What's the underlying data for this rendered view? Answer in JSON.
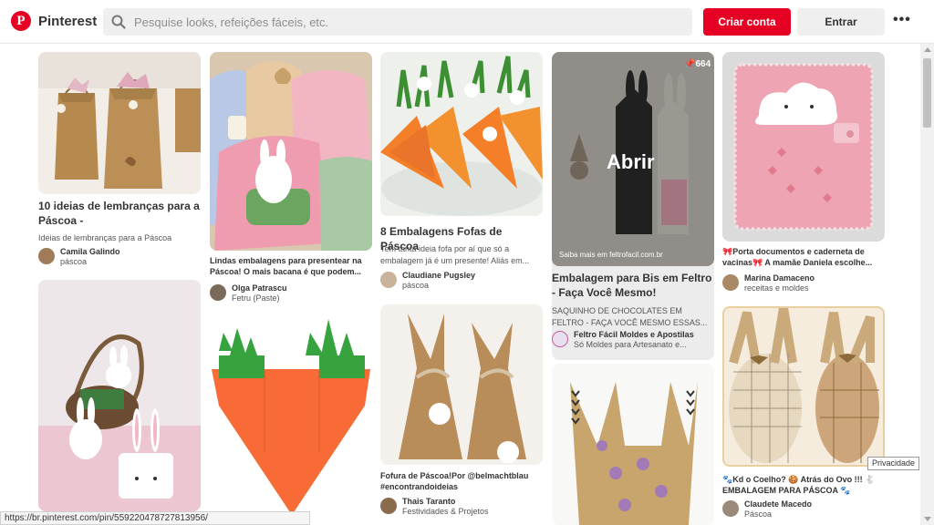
{
  "header": {
    "brand": "Pinterest",
    "search_placeholder": "Pesquise looks, refeições fáceis, etc.",
    "signup_label": "Criar conta",
    "login_label": "Entrar",
    "more_label": "•••"
  },
  "pins": [
    {
      "title": "10 ideias de lembranças para a Páscoa -",
      "desc": "Ideias de lembranças para a Páscoa",
      "user": "Camila Galindo",
      "board": "páscoa"
    },
    {
      "title": "Lindas embalagens para presentear na Páscoa! O mais bacana é que podem...",
      "user": "Olga Patrascu",
      "board": "Fetru (Paste)"
    },
    {
      "title": "8 Embalagens Fofas de Páscoa",
      "desc": "Tem tanta ideia fofa por aí que só a embalagem já é um presente! Aliás em...",
      "user": "Claudiane Pugsley",
      "board": "páscoa"
    },
    {
      "title": "Embalagem para Bis em Feltro - Faça Você Mesmo!",
      "desc": "SAQUINHO DE CHOCOLATES EM FELTRO - FAÇA VOCÊ MESMO ESSAS...",
      "user": "Feltro Fácil Moldes e Apostilas",
      "board": "Só Moldes para Artesanato e...",
      "overlay_open": "Abrir",
      "overlay_link": "Saiba mais em feltrofacil.com.br",
      "save_count": "664"
    },
    {
      "title": "🎀Porta documentos e caderneta de vacinas🎀 A mamãe Daniela escolhe...",
      "user": "Marina Damaceno",
      "board": "receitas e moldes"
    },
    {
      "title": "Fofura de Páscoa!Por @belmachtblau #encontrandoideias",
      "user": "Thais Taranto",
      "board": "Festividades & Projetos"
    },
    {
      "title": "🐾Kd o Coelho? 🍪 Atrás do Ovo !!! 🐇 EMBALAGEM PARA PÁSCOA 🐾",
      "user": "Claudete Macedo",
      "board": "Páscoa"
    }
  ],
  "status_url": "https://br.pinterest.com/pin/559220478727813956/",
  "tooltip": "Privacidade"
}
